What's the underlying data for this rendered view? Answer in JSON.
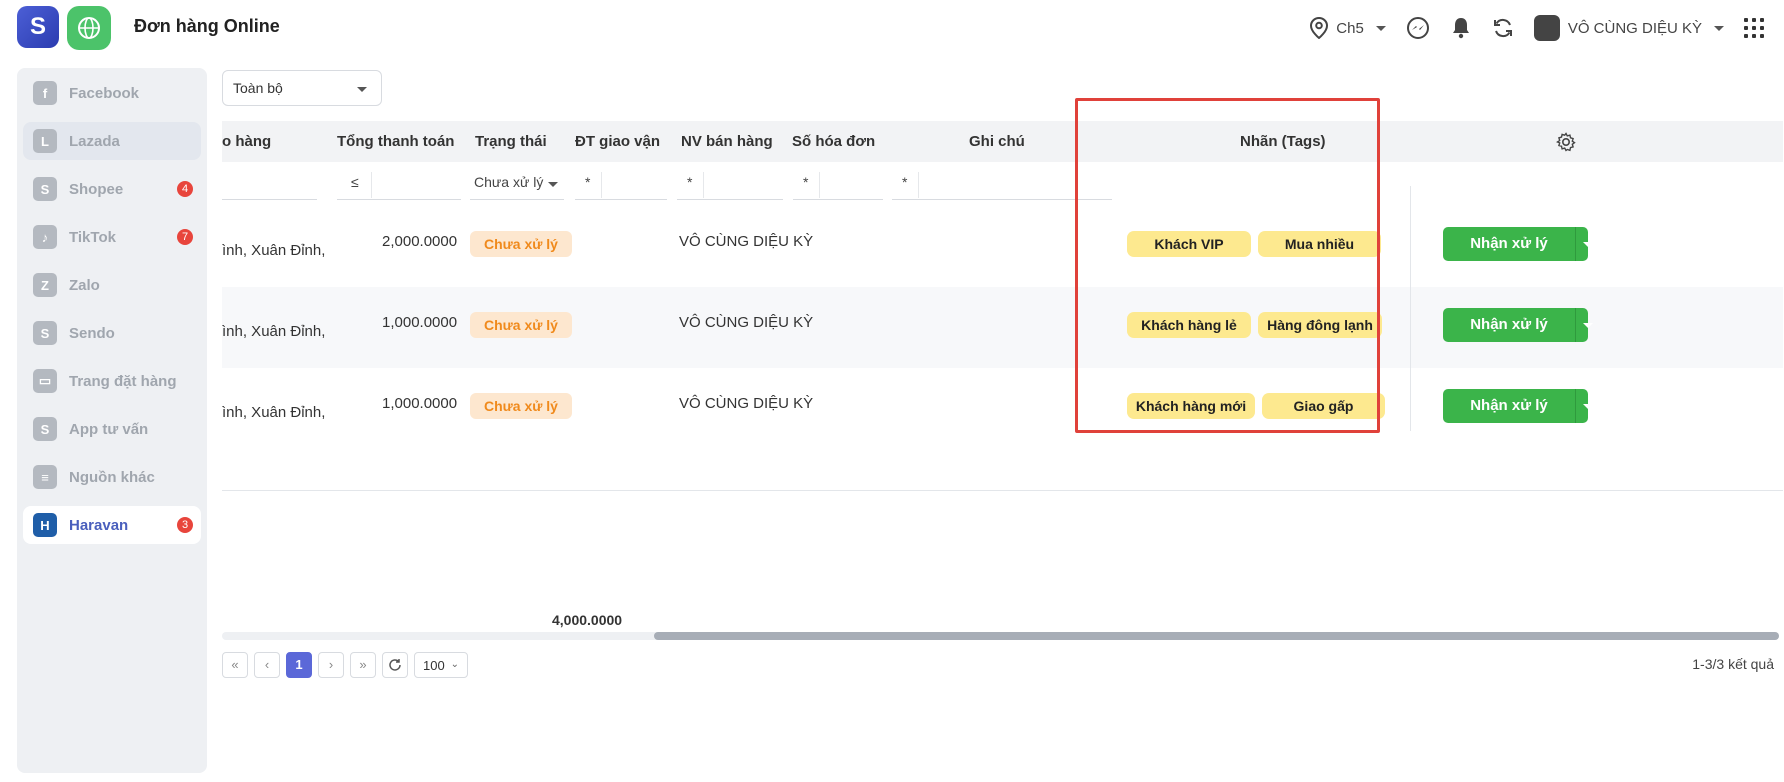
{
  "header": {
    "title": "Đơn hàng Online",
    "location": "Ch5",
    "user": "VÔ CÙNG DIỆU KỲ"
  },
  "sidebar": {
    "items": [
      {
        "label": "Facebook",
        "icon": "facebook-icon",
        "badge": ""
      },
      {
        "label": "Lazada",
        "icon": "lazada-icon",
        "badge": ""
      },
      {
        "label": "Shopee",
        "icon": "shopee-icon",
        "badge": "4"
      },
      {
        "label": "TikTok",
        "icon": "tiktok-icon",
        "badge": "7"
      },
      {
        "label": "Zalo",
        "icon": "zalo-icon",
        "badge": ""
      },
      {
        "label": "Sendo",
        "icon": "sendo-icon",
        "badge": ""
      },
      {
        "label": "Trang đặt hàng",
        "icon": "cart-icon",
        "badge": ""
      },
      {
        "label": "App tư vấn",
        "icon": "app-icon",
        "badge": ""
      },
      {
        "label": "Nguồn khác",
        "icon": "document-icon",
        "badge": ""
      },
      {
        "label": "Haravan",
        "icon": "haravan-icon",
        "badge": "3"
      }
    ]
  },
  "filter": {
    "scope": "Toàn bộ"
  },
  "table": {
    "columns": [
      "o hàng",
      "Tổng thanh toán",
      "Trạng thái",
      "ĐT giao vận",
      "NV bán hàng",
      "Số hóa đơn",
      "Ghi chú",
      "Nhãn (Tags)"
    ],
    "filters": {
      "total": "≤",
      "status": "Chưa xử lý",
      "shipping": "*",
      "seller": "*",
      "invoice": "*",
      "note": "*"
    },
    "rows": [
      {
        "address": "ình, Xuân Đỉnh,",
        "total": "2,000.0000",
        "status": "Chưa xử lý",
        "seller": "VÔ CÙNG DIỆU KỲ",
        "tags": [
          "Khách VIP",
          "Mua nhiều"
        ],
        "action": "Nhận xử lý"
      },
      {
        "address": "ình, Xuân Đỉnh,",
        "total": "1,000.0000",
        "status": "Chưa xử lý",
        "seller": "VÔ CÙNG DIỆU KỲ",
        "tags": [
          "Khách hàng lẻ",
          "Hàng đông lạnh"
        ],
        "action": "Nhận xử lý"
      },
      {
        "address": "ình, Xuân Đỉnh,",
        "total": "1,000.0000",
        "status": "Chưa xử lý",
        "seller": "VÔ CÙNG DIỆU KỲ",
        "tags": [
          "Khách hàng mới",
          "Giao gấp"
        ],
        "action": "Nhận xử lý"
      }
    ],
    "sum_total": "4,000.0000"
  },
  "pagination": {
    "first": "«",
    "prev": "‹",
    "current": "1",
    "next": "›",
    "last": "»",
    "page_size": "100",
    "result": "1-3/3 kết quả"
  }
}
